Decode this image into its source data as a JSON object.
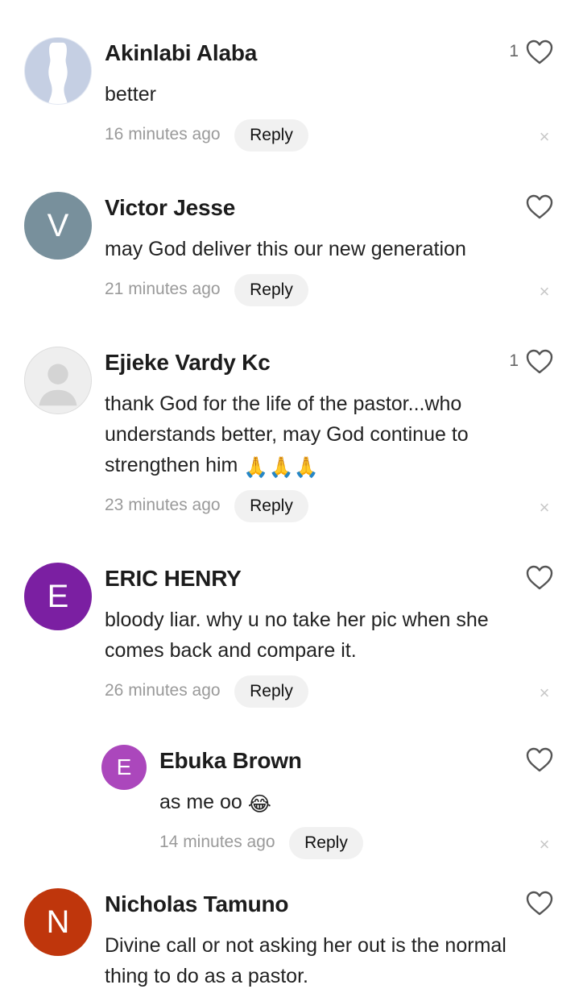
{
  "comments": [
    {
      "author": "Akinlabi Alaba",
      "text": "better",
      "time": "16 minutes ago",
      "reply_label": "Reply",
      "like_count": "1",
      "avatar_letter": "",
      "avatar_color": "#c5cfe3"
    },
    {
      "author": "Victor Jesse",
      "text": "may God deliver this our new generation",
      "time": "21 minutes ago",
      "reply_label": "Reply",
      "like_count": "",
      "avatar_letter": "V",
      "avatar_color": "#78909c"
    },
    {
      "author": "Ejieke Vardy Kc",
      "text_lines": [
        "thank God for the life of the pastor...who",
        "understands better, may God continue to",
        "strengthen him"
      ],
      "emoji": "🙏🙏🙏",
      "time": "23 minutes ago",
      "reply_label": "Reply",
      "like_count": "1",
      "avatar_letter": "",
      "avatar_color": "#eeeeee"
    },
    {
      "author": "ERIC HENRY",
      "text_lines": [
        "bloody liar. why u no take her pic when she",
        "comes back and compare it."
      ],
      "time": "26 minutes ago",
      "reply_label": "Reply",
      "like_count": "",
      "avatar_letter": "E",
      "avatar_color": "#7b1fa2"
    },
    {
      "author": "Ebuka Brown",
      "text": "as me oo",
      "emoji": "😂",
      "time": "14 minutes ago",
      "reply_label": "Reply",
      "like_count": "",
      "avatar_letter": "E",
      "avatar_color": "#ab47bc"
    },
    {
      "author": "Nicholas Tamuno",
      "text_lines": [
        "Divine call or not asking her out is the normal",
        "thing to do as a pastor."
      ],
      "like_count": "",
      "avatar_letter": "N",
      "avatar_color": "#bf360c"
    }
  ],
  "icons": {
    "like": "heart-outline-icon",
    "dismiss": "close-icon"
  },
  "colors": {
    "reply_bg": "#f1f1f1",
    "time_text": "#9a9a9a",
    "heart_stroke": "#555555"
  }
}
